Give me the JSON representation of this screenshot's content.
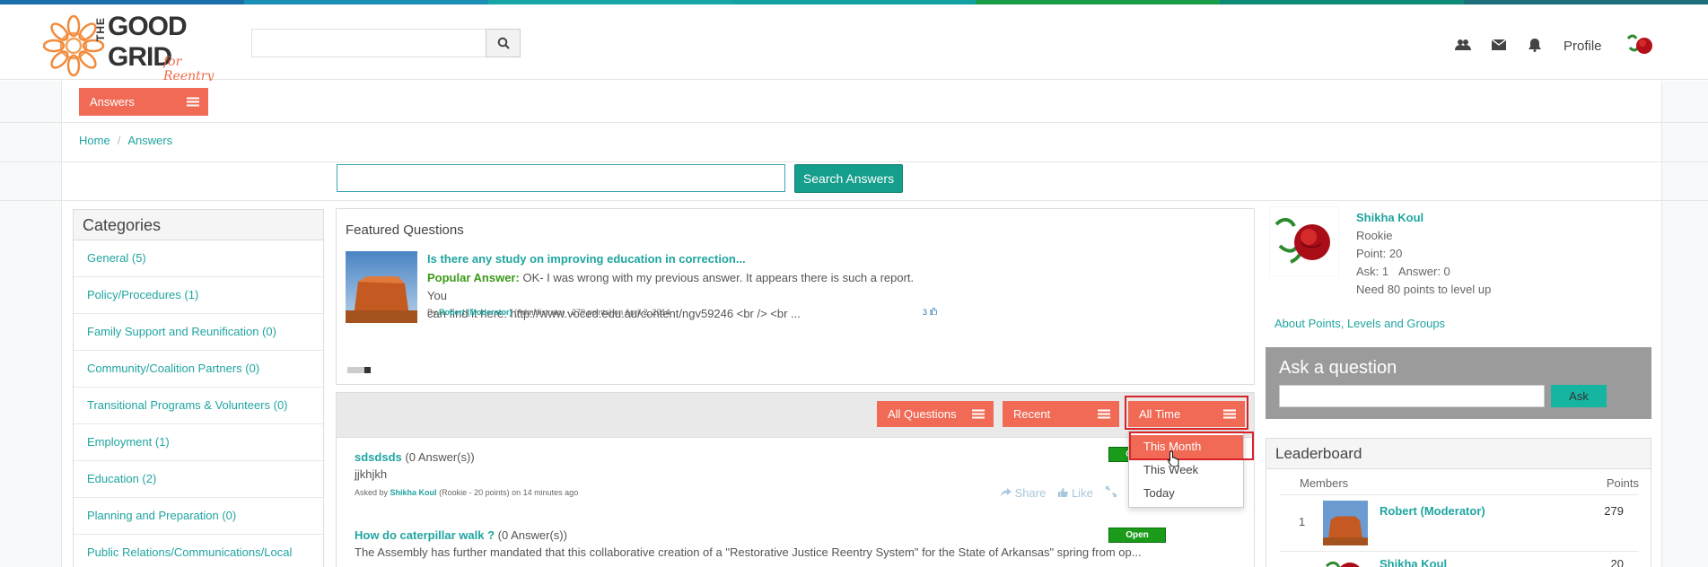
{
  "colors": {
    "stripe": [
      "#1a6fa8",
      "#1a8fb5",
      "#17a5a8",
      "#13a0a3",
      "#1a9c4a",
      "#0e8a78",
      "#1f6f7a"
    ],
    "accent": "#f06a55",
    "teal": "#1fa5a0",
    "open_green": "#1a9c1a"
  },
  "header": {
    "logo": {
      "the": "THE",
      "good": "GOOD",
      "grid": "GRID",
      "for": "for Reentry"
    },
    "search_placeholder": "",
    "search_icon": "search-icon",
    "icons": [
      "users-icon",
      "envelope-icon",
      "bell-icon"
    ],
    "profile_label": "Profile"
  },
  "answers_menu": {
    "label": "Answers"
  },
  "breadcrumb": {
    "home": "Home",
    "current": "Answers"
  },
  "answer_search": {
    "placeholder": "",
    "button": "Search Answers"
  },
  "categories": {
    "title": "Categories",
    "items": [
      "General (5)",
      "Policy/Procedures (1)",
      "Family Support and Reunification (0)",
      "Community/Coalition Partners (0)",
      "Transitional Programs & Volunteers (0)",
      "Employment (1)",
      "Education (2)",
      "Planning and Preparation (0)",
      "Public Relations/Communications/Local"
    ]
  },
  "featured": {
    "title": "Featured Questions",
    "question": "Is there any study on improving education in correction...",
    "popular_label": "Popular Answer:",
    "answer_line1": "OK- I was wrong with my previous answer. It appears there is such a report. You",
    "answer_line2": "can find it here: http://www.voced.edu.au/content/ngv59246 <br /> <br ...",
    "by": "By",
    "author": "Robert (Moderator)",
    "author_meta": "(Administrator - 279 points)",
    "date": "on April 2, 2014",
    "likes": "3"
  },
  "filters": {
    "all_questions": "All Questions",
    "recent": "Recent",
    "all_time": "All Time",
    "options": [
      "This Month",
      "This Week",
      "Today"
    ],
    "active_option": "This Month"
  },
  "questions": [
    {
      "title": "sdsdsds",
      "count": "(0 Answer(s))",
      "body": "jjkhjkh",
      "asked_by": "Asked by",
      "author": "Shikha Koul",
      "meta": "(Rookie - 20 points)",
      "time": "on 14 minutes ago",
      "status": "Open",
      "share": "Share",
      "like": "Like"
    },
    {
      "title": "How do caterpillar walk ?",
      "count": "(0 Answer(s))",
      "body": "The Assembly has further mandated that this collaborative creation of a \"Restorative Justice Reentry System\" for the State of Arkansas\" spring from op...",
      "status": "Open"
    }
  ],
  "profile": {
    "name": "Shikha Koul",
    "rank": "Rookie",
    "points": "Point: 20",
    "ask": "Ask: 1",
    "answer": "Answer: 0",
    "need": "Need 80 points to level up",
    "about": "About Points, Levels and Groups"
  },
  "ask_box": {
    "title": "Ask a question",
    "placeholder": "",
    "button": "Ask"
  },
  "leaderboard": {
    "title": "Leaderboard",
    "col_members": "Members",
    "col_points": "Points",
    "rows": [
      {
        "rank": "1",
        "name": "Robert (Moderator)",
        "points": "279"
      },
      {
        "rank": "",
        "name": "Shikha Koul",
        "points": "20"
      }
    ]
  }
}
